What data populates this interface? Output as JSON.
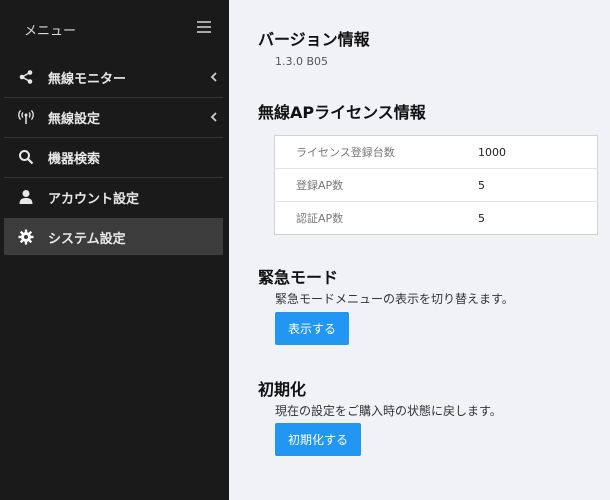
{
  "sidebar": {
    "title": "メニュー",
    "items": [
      {
        "label": "無線モニター",
        "icon": "share-icon",
        "has_submenu": true
      },
      {
        "label": "無線設定",
        "icon": "wireless-antenna-icon",
        "has_submenu": true
      },
      {
        "label": "機器検索",
        "icon": "search-icon",
        "has_submenu": false
      },
      {
        "label": "アカウント設定",
        "icon": "user-icon",
        "has_submenu": false
      },
      {
        "label": "システム設定",
        "icon": "gear-icon",
        "has_submenu": false,
        "active": true
      }
    ]
  },
  "version": {
    "heading": "バージョン情報",
    "value": "1.3.0 B05"
  },
  "license": {
    "heading": "無線APライセンス情報",
    "rows": [
      {
        "key": "ライセンス登録台数",
        "value": "1000"
      },
      {
        "key": "登録AP数",
        "value": "5"
      },
      {
        "key": "認証AP数",
        "value": "5"
      }
    ]
  },
  "emergency": {
    "heading": "緊急モード",
    "description": "緊急モードメニューの表示を切り替えます。",
    "button_label": "表示する"
  },
  "reset": {
    "heading": "初期化",
    "description": "現在の設定をご購入時の状態に戻します。",
    "button_label": "初期化する"
  },
  "colors": {
    "sidebar_bg": "#1a1a1a",
    "active_item_bg": "#3c3c3c",
    "main_bg": "#f1f2f6",
    "button": "#2196f3"
  }
}
